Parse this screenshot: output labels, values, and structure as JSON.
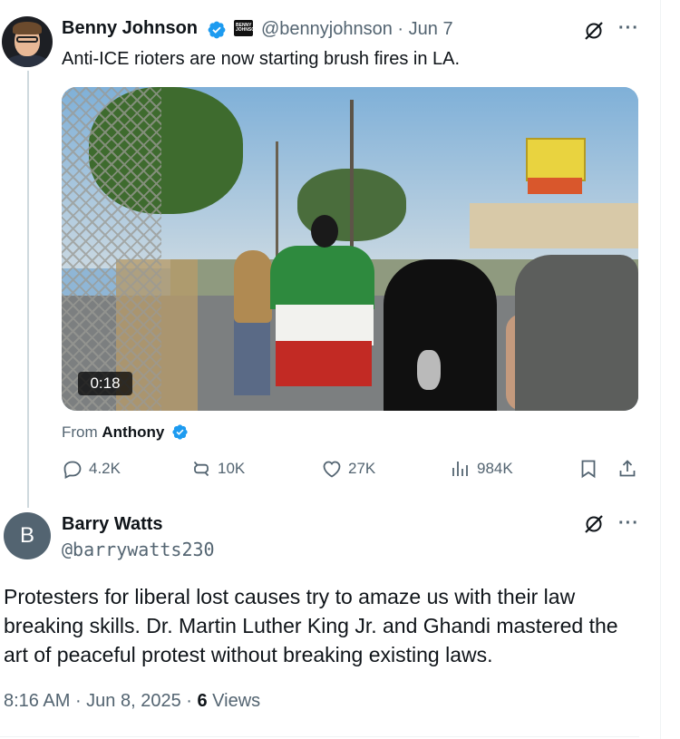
{
  "tweet": {
    "author_name": "Benny Johnson",
    "handle": "@bennyjohnson",
    "separator": " · ",
    "date": "Jun 7",
    "text": "Anti-ICE rioters are now starting brush fires in LA.",
    "verified": true,
    "affiliate_badge_text": "BENNY JOHNSON",
    "more_label": "···",
    "video_duration": "0:18",
    "from_prefix": "From ",
    "from_name": "Anthony",
    "stats": {
      "replies": "4.2K",
      "reposts": "10K",
      "likes": "27K",
      "views": "984K"
    }
  },
  "reply": {
    "avatar_letter": "B",
    "author_name": "Barry Watts",
    "handle": "@barrywatts230",
    "more_label": "···",
    "text": "Protesters for liberal lost causes try to amaze us with their law breaking skills. Dr. Martin Luther King Jr. and Ghandi mastered the art of peaceful protest without breaking existing laws.",
    "time": "8:16 AM",
    "date": "Jun 8, 2025",
    "views_count": "6",
    "views_label": "Views"
  },
  "colors": {
    "text_primary": "#0f1419",
    "text_secondary": "#536471",
    "verified_blue": "#1d9bf0",
    "divider": "#eff3f4"
  },
  "icons": [
    "verified-icon",
    "grok-icon",
    "reply-icon",
    "repost-icon",
    "like-icon",
    "views-icon",
    "bookmark-icon",
    "share-icon"
  ]
}
